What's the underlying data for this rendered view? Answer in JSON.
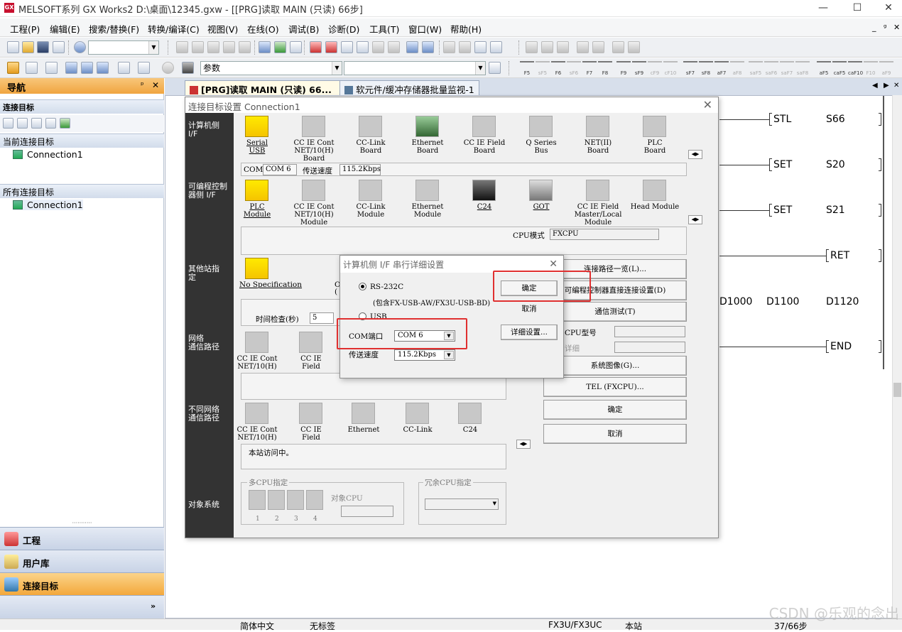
{
  "window": {
    "title": "MELSOFT系列 GX Works2 D:\\桌面\\12345.gxw - [[PRG]读取 MAIN (只读) 66步]",
    "logo": "GX"
  },
  "menu": [
    "工程(P)",
    "编辑(E)",
    "搜索/替换(F)",
    "转换/编译(C)",
    "视图(V)",
    "在线(O)",
    "调试(B)",
    "诊断(D)",
    "工具(T)",
    "窗口(W)",
    "帮助(H)"
  ],
  "toolbar": {
    "device_combo": "参数",
    "fkeys": [
      "F5",
      "sF5",
      "F6",
      "sF6",
      "F7",
      "F8",
      "F9",
      "sF9",
      "cF9",
      "cF10",
      "sF7",
      "sF8",
      "aF7",
      "aF8",
      "saF5",
      "saF6",
      "saF7",
      "saF8",
      "aF5",
      "caF5",
      "caF10",
      "F10",
      "aF9"
    ]
  },
  "nav": {
    "title": "导航",
    "pin": "ᵖ",
    "close": "✕",
    "section": "连接目标",
    "current_label": "当前连接目标",
    "current_item": "Connection1",
    "all_label": "所有连接目标",
    "all_item": "Connection1",
    "grip": "···········",
    "bottom": [
      "工程",
      "用户库",
      "连接目标"
    ],
    "more": "»"
  },
  "tabs": [
    {
      "label": "[PRG]读取 MAIN (只读) 66...",
      "close": "✕"
    },
    {
      "label": "软元件/缓冲存储器批量监视-1"
    }
  ],
  "tab_nav": [
    "◀",
    "▶",
    "✕"
  ],
  "ladder": {
    "rows": [
      {
        "inst": "STL",
        "op": "S66"
      },
      {
        "inst": "SET",
        "op": "S20"
      },
      {
        "inst": "SET",
        "op": "S21"
      },
      {
        "inst": "RET",
        "op": ""
      },
      {
        "inst": "END",
        "op": ""
      }
    ],
    "data_row": [
      "D1000",
      "D1100",
      "D1120"
    ]
  },
  "dialog": {
    "title": "连接目标设置 Connection1",
    "close": "✕",
    "side": [
      "计算机侧\nI/F",
      "可编程控制\n器侧 I/F",
      "其他站指\n定",
      "网络\n通信路径",
      "不同网络\n通信路径",
      "对象系统"
    ],
    "pc_if": [
      "Serial\nUSB",
      "CC IE Cont\nNET/10(H)\nBoard",
      "CC-Link\nBoard",
      "Ethernet\nBoard",
      "CC IE Field\nBoard",
      "Q Series\nBus",
      "NET(II)\nBoard",
      "PLC\nBoard"
    ],
    "pc_info": {
      "com_label": "COM",
      "com_value": "COM 6",
      "speed_label": "传送速度",
      "speed_value": "115.2Kbps"
    },
    "plc_if": [
      "PLC\nModule",
      "CC IE Cont\nNET/10(H)\nModule",
      "CC-Link\nModule",
      "Ethernet\nModule",
      "C24",
      "GOT",
      "CC IE Field\nMaster/Local\nModule",
      "Head Module"
    ],
    "cpu_mode_label": "CPU模式",
    "cpu_mode_value": "FXCPU",
    "other_station": "No Specification",
    "other_station_extra": "O",
    "other_station_extra2": "(",
    "time_check_label": "时间检查(秒)",
    "time_check_value": "5",
    "net_route": [
      "CC IE Cont\nNET/10(H)",
      "CC IE\nField"
    ],
    "diff_route": [
      "CC IE Cont\nNET/10(H)",
      "CC IE\nField",
      "Ethernet",
      "CC-Link",
      "C24"
    ],
    "access_msg": "本站访问中。",
    "multi_cpu_label": "多CPU指定",
    "target_cpu_label": "对象CPU",
    "cpu_nums": [
      "1",
      "2",
      "3",
      "4"
    ],
    "redundant_label": "冗余CPU指定",
    "right_buttons": [
      "连接路径一览(L)...",
      "可编程控制器直接连接设置(D)",
      "通信测试(T)",
      "系统图像(G)...",
      "TEL (FXCPU)...",
      "确定",
      "取消"
    ],
    "cpu_type_label": "CPU型号",
    "detail_label": "详细",
    "scroll": [
      "◀",
      "▶"
    ]
  },
  "serial": {
    "title": "计算机侧 I/F 串行详细设置",
    "close": "✕",
    "rs232": "RS-232C",
    "rs232_note": "(包含FX-USB-AW/FX3U-USB-BD)",
    "usb": "USB",
    "com_label": "COM端口",
    "com_value": "COM 6",
    "speed_label": "传送速度",
    "speed_value": "115.2Kbps",
    "ok": "确定",
    "cancel": "取消",
    "detail": "详细设置..."
  },
  "status": {
    "lang": "简体中文",
    "label": "无标签",
    "cpu": "FX3U/FX3UC",
    "station": "本站",
    "steps": "37/66步"
  },
  "watermark": "CSDN @乐观的念出",
  "colors": {
    "nav_header": "#f0a540",
    "highlight": "#e03030",
    "sidebar": "#333333"
  }
}
